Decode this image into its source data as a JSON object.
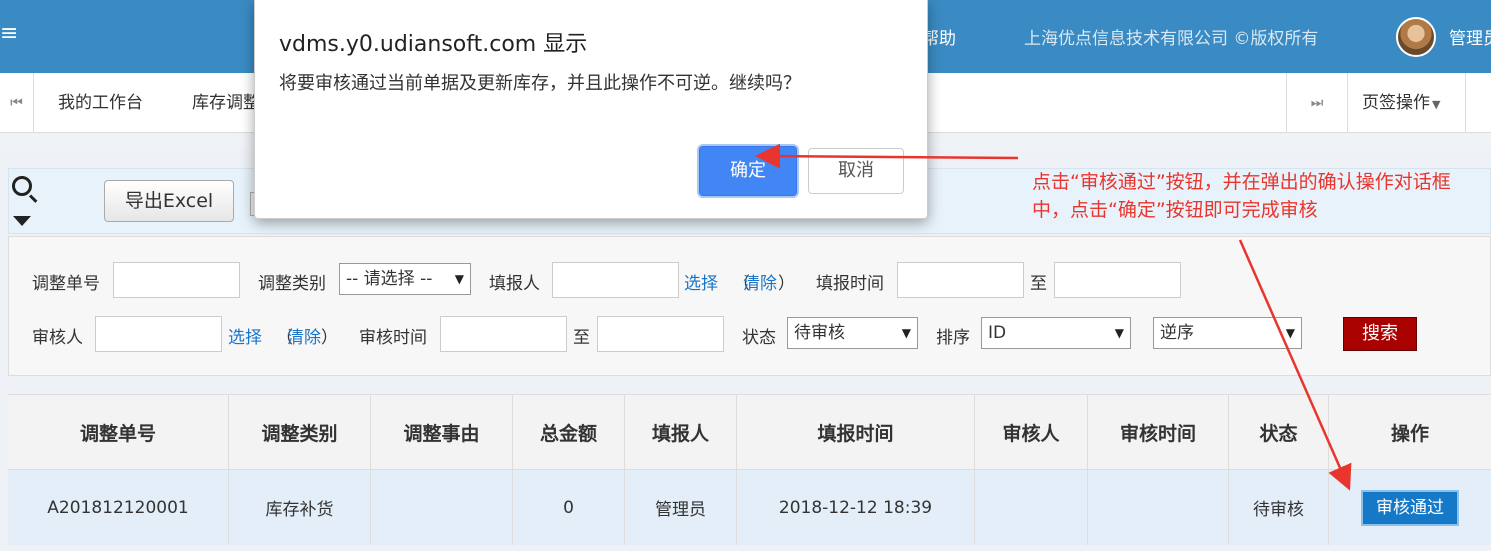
{
  "topbar": {
    "menu_icon": "≡",
    "help": "帮助",
    "copyright": "上海优点信息技术有限公司 ©版权所有",
    "user": "管理员"
  },
  "tabs": {
    "prev_icon": "⏮",
    "items": [
      "我的工作台",
      "库存调整"
    ],
    "next_icon": "⏭",
    "ops_label": "页签操作"
  },
  "toolbar": {
    "export_label": "导出Excel"
  },
  "filters": {
    "adjust_no_label": "调整单号",
    "adjust_type_label": "调整类别",
    "adjust_type_value": "-- 请选择 --",
    "reporter_label": "填报人",
    "select_link": "选择",
    "clear_link": "清除",
    "report_time_label": "填报时间",
    "to_label": "至",
    "reviewer_label": "审核人",
    "review_time_label": "审核时间",
    "status_label": "状态",
    "status_value": "待审核",
    "sort_label": "排序",
    "sort_value": "ID",
    "order_value": "逆序",
    "search_label": "搜索"
  },
  "table": {
    "headers": [
      "调整单号",
      "调整类别",
      "调整事由",
      "总金额",
      "填报人",
      "填报时间",
      "审核人",
      "审核时间",
      "状态",
      "操作"
    ],
    "rows": [
      {
        "no": "A201812120001",
        "type": "库存补货",
        "reason": "",
        "amount": "0",
        "reporter": "管理员",
        "time": "2018-12-12 18:39",
        "reviewer": "",
        "review_time": "",
        "status": "待审核",
        "action": "审核通过"
      }
    ]
  },
  "dialog": {
    "title": "vdms.y0.udiansoft.com 显示",
    "message": "将要审核通过当前单据及更新库存，并且此操作不可逆。继续吗？",
    "ok": "确定",
    "cancel": "取消"
  },
  "annotation": {
    "text": "点击“审核通过”按钮，并在弹出的确认操作对话框中，点击“确定”按钮即可完成审核",
    "color": "#e8352e"
  },
  "colors": {
    "topbar": "#3a8bc3",
    "primary_button": "#4285f4",
    "search_button": "#a90000",
    "approve_button": "#1679c7"
  }
}
